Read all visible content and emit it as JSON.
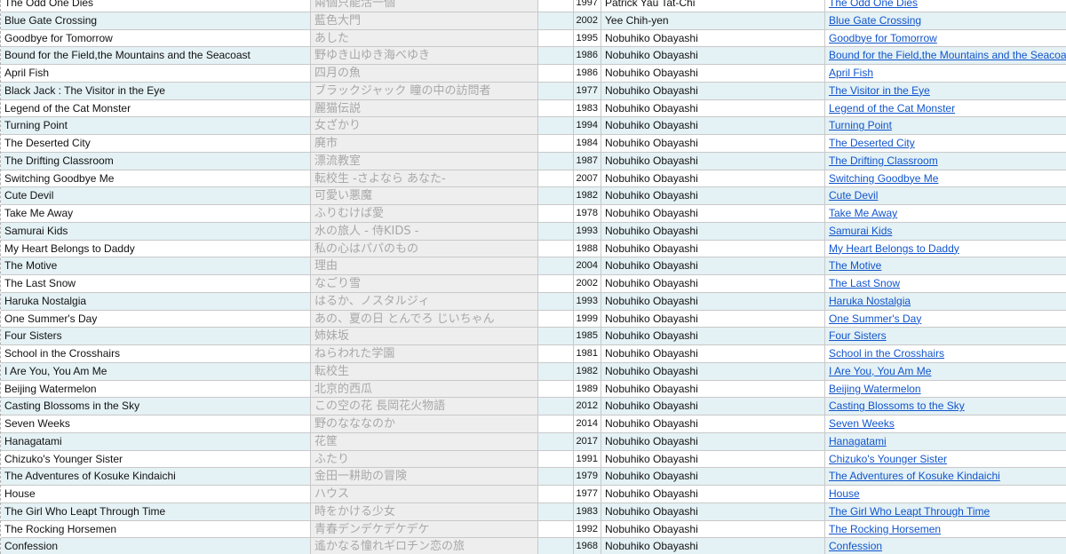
{
  "rows": [
    {
      "title": "The Odd One Dies",
      "jp": "兩個只能活一個",
      "year": "1997",
      "director": "Patrick Yau Tat-Chi",
      "link": "The Odd One Dies"
    },
    {
      "title": "Blue Gate Crossing",
      "jp": "藍色大門",
      "year": "2002",
      "director": "Yee Chih-yen",
      "link": "Blue Gate Crossing"
    },
    {
      "title": "Goodbye for Tomorrow",
      "jp": "あした",
      "year": "1995",
      "director": "Nobuhiko Obayashi",
      "link": "Goodbye for Tomorrow"
    },
    {
      "title": "Bound for the Field,the Mountains and the Seacoast",
      "jp": "野ゆき山ゆき海べゆき",
      "year": "1986",
      "director": "Nobuhiko Obayashi",
      "link": "Bound for the Field,the Mountains and the Seacoast"
    },
    {
      "title": "April Fish",
      "jp": "四月の魚",
      "year": "1986",
      "director": "Nobuhiko Obayashi",
      "link": "April Fish"
    },
    {
      "title": "Black Jack : The Visitor in the Eye",
      "jp": "ブラックジャック 瞳の中の訪問者",
      "year": "1977",
      "director": "Nobuhiko Obayashi",
      "link": "The Visitor in the Eye"
    },
    {
      "title": "Legend of the Cat Monster",
      "jp": "麗猫伝説",
      "year": "1983",
      "director": "Nobuhiko Obayashi",
      "link": "Legend of the Cat Monster"
    },
    {
      "title": "Turning Point",
      "jp": "女ざかり",
      "year": "1994",
      "director": "Nobuhiko Obayashi",
      "link": "Turning Point"
    },
    {
      "title": "The Deserted City",
      "jp": "廃市",
      "year": "1984",
      "director": "Nobuhiko Obayashi",
      "link": "The Deserted City"
    },
    {
      "title": "The Drifting Classroom",
      "jp": "漂流教室",
      "year": "1987",
      "director": "Nobuhiko Obayashi",
      "link": "The Drifting Classroom"
    },
    {
      "title": "Switching Goodbye Me",
      "jp": "転校生 -さよなら あなた-",
      "year": "2007",
      "director": "Nobuhiko Obayashi",
      "link": "Switching Goodbye Me"
    },
    {
      "title": "Cute Devil",
      "jp": "可愛い悪魔",
      "year": "1982",
      "director": "Nobuhiko Obayashi",
      "link": "Cute Devil"
    },
    {
      "title": "Take Me Away",
      "jp": "ふりむけば愛",
      "year": "1978",
      "director": "Nobuhiko Obayashi",
      "link": "Take Me Away"
    },
    {
      "title": "Samurai Kids",
      "jp": "水の旅人 - 侍KIDS -",
      "year": "1993",
      "director": "Nobuhiko Obayashi",
      "link": "Samurai Kids"
    },
    {
      "title": "My Heart Belongs to Daddy",
      "jp": "私の心はパパのもの",
      "year": "1988",
      "director": "Nobuhiko Obayashi",
      "link": "My Heart Belongs to Daddy"
    },
    {
      "title": "The Motive",
      "jp": "理由",
      "year": "2004",
      "director": "Nobuhiko Obayashi",
      "link": "The Motive"
    },
    {
      "title": "The Last Snow",
      "jp": "なごり雪",
      "year": "2002",
      "director": "Nobuhiko Obayashi",
      "link": "The Last Snow"
    },
    {
      "title": "Haruka Nostalgia",
      "jp": "はるか、ノスタルジィ",
      "year": "1993",
      "director": "Nobuhiko Obayashi",
      "link": "Haruka Nostalgia"
    },
    {
      "title": "One Summer's Day",
      "jp": "あの、夏の日 とんでろ じいちゃん",
      "year": "1999",
      "director": "Nobuhiko Obayashi",
      "link": "One Summer's Day"
    },
    {
      "title": "Four Sisters",
      "jp": "姉妹坂",
      "year": "1985",
      "director": "Nobuhiko Obayashi",
      "link": "Four Sisters"
    },
    {
      "title": "School in the Crosshairs",
      "jp": "ねらわれた学園",
      "year": "1981",
      "director": "Nobuhiko Obayashi",
      "link": "School in the Crosshairs"
    },
    {
      "title": "I Are You, You Am Me",
      "jp": "転校生",
      "year": "1982",
      "director": "Nobuhiko Obayashi",
      "link": "I Are You, You Am Me"
    },
    {
      "title": "Beijing Watermelon",
      "jp": "北京的西瓜",
      "year": "1989",
      "director": "Nobuhiko Obayashi",
      "link": "Beijing Watermelon"
    },
    {
      "title": "Casting Blossoms in the Sky",
      "jp": "この空の花 長岡花火物語",
      "year": "2012",
      "director": "Nobuhiko Obayashi",
      "link": "Casting Blossoms to the Sky"
    },
    {
      "title": "Seven Weeks",
      "jp": "野のなななのか",
      "year": "2014",
      "director": "Nobuhiko Obayashi",
      "link": "Seven Weeks"
    },
    {
      "title": "Hanagatami",
      "jp": "花筐",
      "year": "2017",
      "director": "Nobuhiko Obayashi",
      "link": "Hanagatami"
    },
    {
      "title": "Chizuko's Younger Sister",
      "jp": "ふたり",
      "year": "1991",
      "director": "Nobuhiko Obayashi",
      "link": "Chizuko's Younger Sister"
    },
    {
      "title": "The Adventures of Kosuke Kindaichi",
      "jp": "金田一耕助の冒険",
      "year": "1979",
      "director": "Nobuhiko Obayashi",
      "link": "The Adventures of Kosuke Kindaichi"
    },
    {
      "title": "House",
      "jp": "ハウス",
      "year": "1977",
      "director": "Nobuhiko Obayashi",
      "link": "House"
    },
    {
      "title": "The Girl Who Leapt Through Time",
      "jp": "時をかける少女",
      "year": "1983",
      "director": "Nobuhiko Obayashi",
      "link": "The Girl Who Leapt Through Time"
    },
    {
      "title": "The Rocking Horsemen",
      "jp": "青春デンデケデケデケ",
      "year": "1992",
      "director": "Nobuhiko Obayashi",
      "link": "The Rocking Horsemen"
    },
    {
      "title": "Confession",
      "jp": "遙かなる憧れギロチン恋の旅",
      "year": "1968",
      "director": "Nobuhiko Obayashi",
      "link": "Confession"
    }
  ],
  "colors": {
    "row_alt": "#e4f1f5",
    "jp_column_bg": "#eeeeee",
    "link": "#1155cc",
    "grid": "#c9c9c9"
  }
}
